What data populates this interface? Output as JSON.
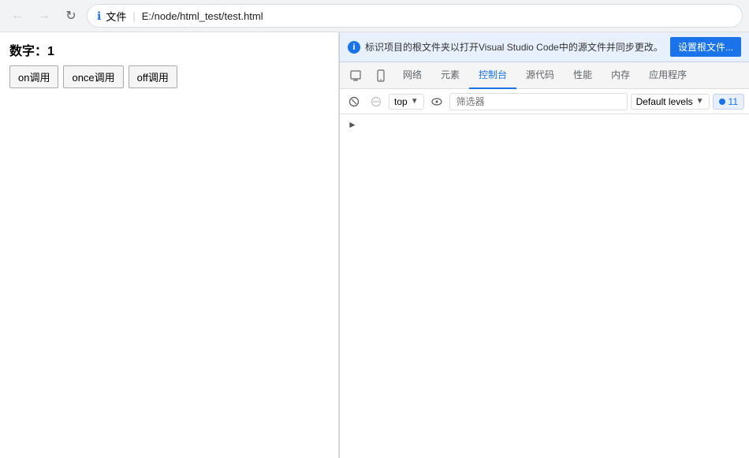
{
  "browser": {
    "back_title": "后退",
    "forward_title": "前进",
    "reload_title": "重新加载",
    "info_icon": "ℹ",
    "address_file_label": "文件",
    "address_separator": "|",
    "address_url": "E:/node/html_test/test.html"
  },
  "webpage": {
    "number_label": "数字：",
    "number_value": "1",
    "buttons": [
      {
        "label": "on调用"
      },
      {
        "label": "once调用"
      },
      {
        "label": "off调用"
      }
    ]
  },
  "devtools": {
    "info_text": "标识项目的根文件夹以打开Visual Studio Code中的源文件并同步更改。",
    "setup_btn_label": "设置根文件...",
    "tabs": [
      {
        "label": "网络",
        "active": false
      },
      {
        "label": "元素",
        "active": false
      },
      {
        "label": "控制台",
        "active": true
      },
      {
        "label": "源代码",
        "active": false
      },
      {
        "label": "性能",
        "active": false
      },
      {
        "label": "内存",
        "active": false
      },
      {
        "label": "应用程序",
        "active": false
      }
    ],
    "toolbar": {
      "clear_label": "清除",
      "block_label": "阻止",
      "context_label": "top",
      "eye_label": "实时表达式",
      "filter_placeholder": "筛选器",
      "levels_label": "Default levels",
      "message_count": "11"
    }
  }
}
